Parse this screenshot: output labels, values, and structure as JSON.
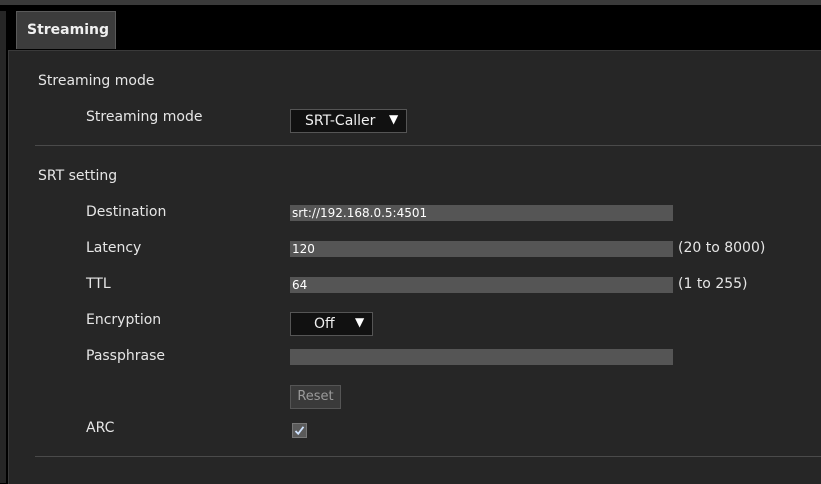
{
  "tab": {
    "label": "Streaming"
  },
  "streaming_mode_section": {
    "title": "Streaming mode",
    "mode_label": "Streaming mode",
    "mode_value": "SRT-Caller"
  },
  "srt_section": {
    "title": "SRT setting",
    "destination": {
      "label": "Destination",
      "value": "srt://192.168.0.5:4501"
    },
    "latency": {
      "label": "Latency",
      "value": "120",
      "range": "(20 to 8000)"
    },
    "ttl": {
      "label": "TTL",
      "value": "64",
      "range": "(1 to 255)"
    },
    "encryption": {
      "label": "Encryption",
      "value": "Off"
    },
    "passphrase": {
      "label": "Passphrase",
      "value": ""
    },
    "reset_label": "Reset",
    "arc": {
      "label": "ARC",
      "checked": true
    }
  },
  "icons": {
    "dropdown": "triangle-down-icon",
    "check": "checkmark-icon"
  },
  "colors": {
    "background": "#262626",
    "input": "#555555",
    "text": "#e6e6e6"
  }
}
